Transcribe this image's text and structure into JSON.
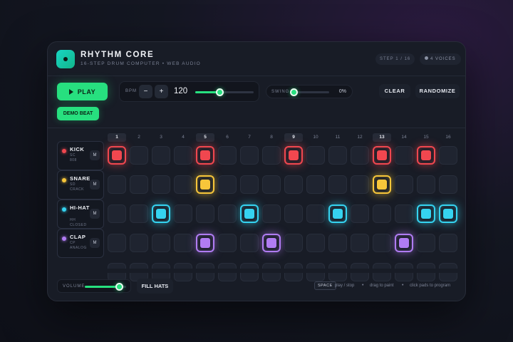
{
  "app": {
    "title": "RHYTHM CORE",
    "subtitle": "16-STEP DRUM COMPUTER • WEB AUDIO"
  },
  "status": {
    "step": "STEP 1 / 16",
    "voices": "4 VOICES"
  },
  "controls": {
    "play": "PLAY",
    "bpm_label": "BPM",
    "bpm_minus": "−",
    "bpm_plus": "+",
    "bpm_value": "120",
    "bpm_slider_fraction": 0.42,
    "swing_label": "SWING",
    "swing_value": "0%",
    "swing_slider_fraction": 0.0,
    "clear": "CLEAR",
    "randomize": "RANDOMIZE",
    "demo": "DEMO BEAT"
  },
  "steps": [
    "1",
    "2",
    "3",
    "4",
    "5",
    "6",
    "7",
    "8",
    "9",
    "10",
    "11",
    "12",
    "13",
    "14",
    "15",
    "16"
  ],
  "accent_steps": [
    1,
    5,
    9,
    13
  ],
  "tracks": [
    {
      "name": "KICK",
      "sub1": "SC",
      "sub2": "808",
      "mute": "M",
      "color": "#f0474f",
      "pattern": [
        1,
        0,
        0,
        0,
        1,
        0,
        0,
        0,
        1,
        0,
        0,
        0,
        1,
        0,
        1,
        0
      ]
    },
    {
      "name": "SNARE",
      "sub1": "SD",
      "sub2": "CRACK",
      "mute": "M",
      "color": "#f7c63a",
      "pattern": [
        0,
        0,
        0,
        0,
        1,
        0,
        0,
        0,
        0,
        0,
        0,
        0,
        1,
        0,
        0,
        0
      ]
    },
    {
      "name": "HI-HAT",
      "sub1": "HH",
      "sub2": "CLOSED",
      "mute": "M",
      "color": "#35d3f0",
      "pattern": [
        0,
        0,
        1,
        0,
        0,
        0,
        1,
        0,
        0,
        0,
        1,
        0,
        0,
        0,
        1,
        1
      ]
    },
    {
      "name": "CLAP",
      "sub1": "CP",
      "sub2": "ANALOG",
      "mute": "M",
      "color": "#b07cf2",
      "pattern": [
        0,
        0,
        0,
        0,
        1,
        0,
        0,
        1,
        0,
        0,
        0,
        0,
        0,
        1,
        0,
        0
      ]
    }
  ],
  "footer": {
    "volume_label": "VOLUME",
    "volume_fraction": 0.82,
    "fill_hats": "FILL HATS",
    "key": "SPACE",
    "hint_play": "play / stop",
    "hint_drag": "drag to paint",
    "hint_click": "click pads to program",
    "bullet": "•"
  },
  "colors": {
    "accent": "#27e07f",
    "panel": "#181c26",
    "background": "#0e1018"
  }
}
